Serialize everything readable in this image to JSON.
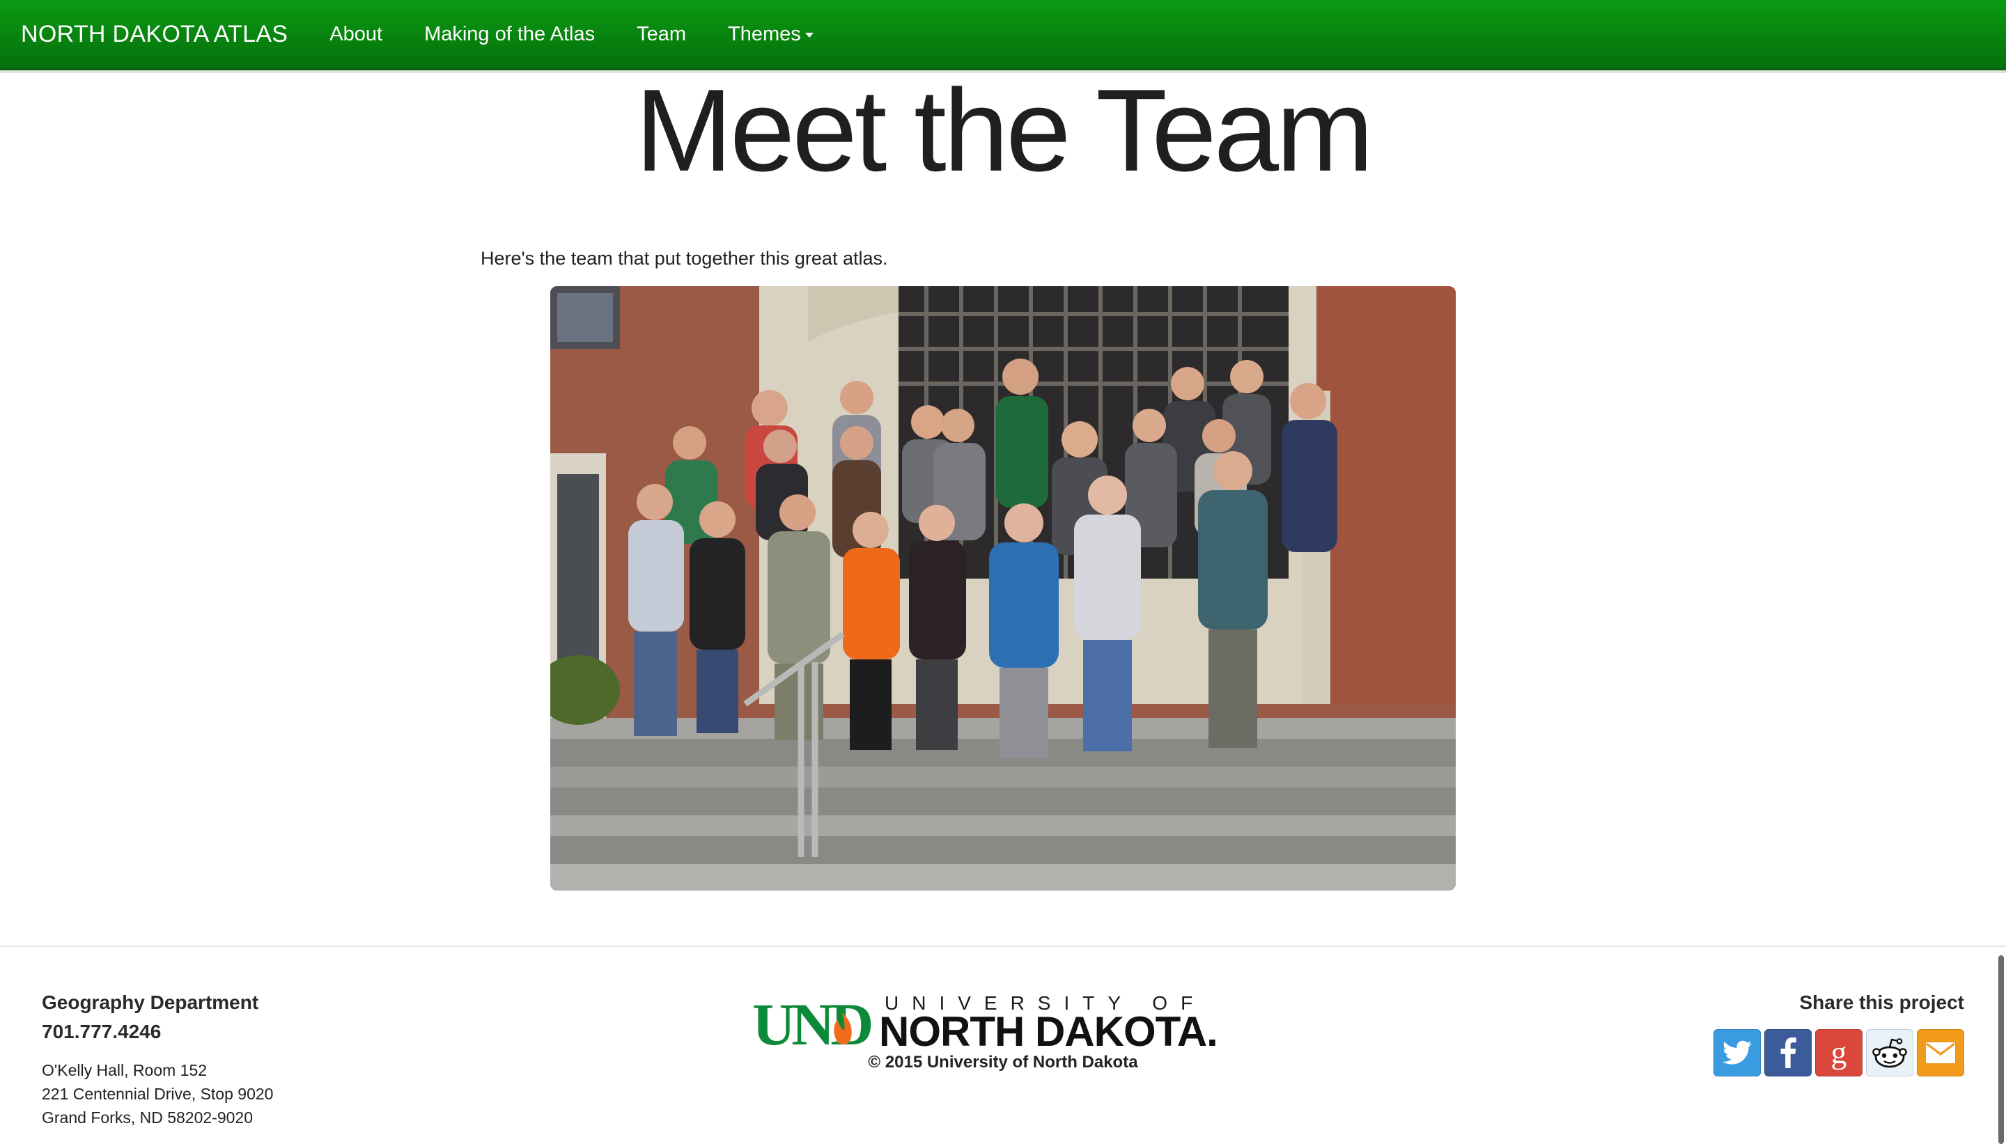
{
  "navbar": {
    "brand": "NORTH DAKOTA ATLAS",
    "links": [
      {
        "label": "About"
      },
      {
        "label": "Making of the Atlas"
      },
      {
        "label": "Team"
      },
      {
        "label": "Themes"
      }
    ],
    "color": "#078a0f"
  },
  "main": {
    "title": "Meet the Team",
    "intro": "Here's the team that put together this great atlas.",
    "photo_icon": "team-photo"
  },
  "footer": {
    "department": "Geography Department",
    "phone": "701.777.4246",
    "address": [
      "O'Kelly Hall, Room 152",
      "221 Centennial Drive, Stop 9020",
      "Grand Forks, ND 58202-9020"
    ],
    "logo": {
      "und": "UND",
      "university_of": "UNIVERSITY OF",
      "north_dakota": "NORTH DAKOTA."
    },
    "copyright": "© 2015 University of North Dakota",
    "share": {
      "title": "Share this project",
      "buttons": [
        {
          "icon": "twitter-icon",
          "color": "#3a9ce0"
        },
        {
          "icon": "facebook-icon",
          "color": "#3b5b99"
        },
        {
          "icon": "google-plus-icon",
          "color": "#d9483b"
        },
        {
          "icon": "reddit-icon",
          "color": "#e8f0f8"
        },
        {
          "icon": "email-icon",
          "color": "#f29a1b"
        }
      ]
    }
  }
}
